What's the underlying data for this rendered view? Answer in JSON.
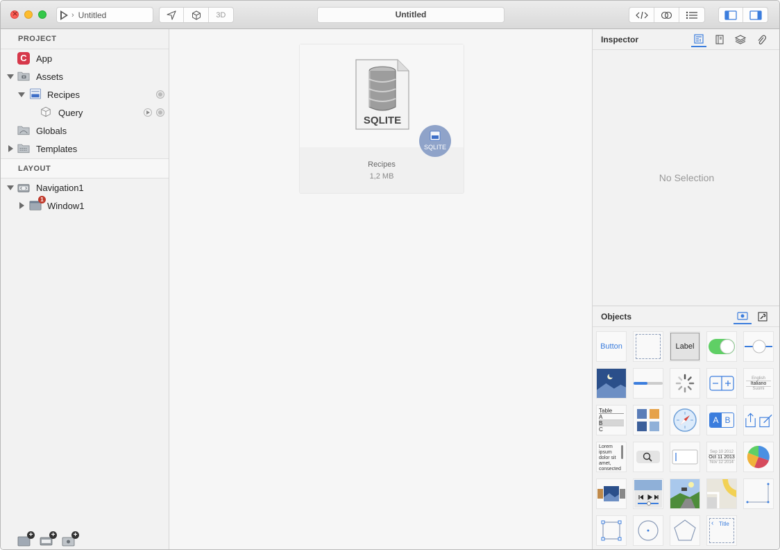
{
  "window": {
    "scheme_name": "Untitled",
    "title": "Untitled",
    "toolbar_left": {
      "btn3d_label": "3D"
    }
  },
  "sidebar": {
    "project_header": "PROJECT",
    "layout_header": "LAYOUT",
    "project_items": [
      {
        "label": "App",
        "icon": "app-icon"
      },
      {
        "label": "Assets",
        "icon": "folder-camera-icon"
      },
      {
        "label": "Recipes",
        "icon": "sql-database-icon"
      },
      {
        "label": "Query",
        "icon": "cube-icon"
      },
      {
        "label": "Globals",
        "icon": "folder-globals-icon"
      },
      {
        "label": "Templates",
        "icon": "folder-templates-icon"
      }
    ],
    "layout_items": [
      {
        "label": "Navigation1",
        "icon": "navigation-icon"
      },
      {
        "label": "Window1",
        "icon": "window-icon",
        "badge": "1"
      }
    ]
  },
  "canvas": {
    "asset": {
      "name": "Recipes",
      "size": "1,2 MB",
      "file_label": "SQLITE",
      "badge_label": "SQLITE"
    }
  },
  "inspector": {
    "title": "Inspector",
    "empty_text": "No Selection"
  },
  "objects": {
    "title": "Objects",
    "button_label": "Button",
    "label_label": "Label",
    "table_label": "Table",
    "table_rows": [
      "A",
      "B",
      "C"
    ],
    "picker_rows": [
      "English",
      "Italiano",
      "Suomi"
    ],
    "lorem_text": "Lorem ipsum dolor sit amet, consected",
    "date_rows": [
      "Sep 10 2012",
      "Oct 11 2013",
      "Nov 12 2014"
    ],
    "navbar_title": "Title",
    "segment_a": "A",
    "segment_b": "B"
  },
  "colors": {
    "accent": "#3b7ddd",
    "badge_red": "#c0392b",
    "toggle_green": "#5fcf65",
    "app_icon": "#d6384a"
  }
}
